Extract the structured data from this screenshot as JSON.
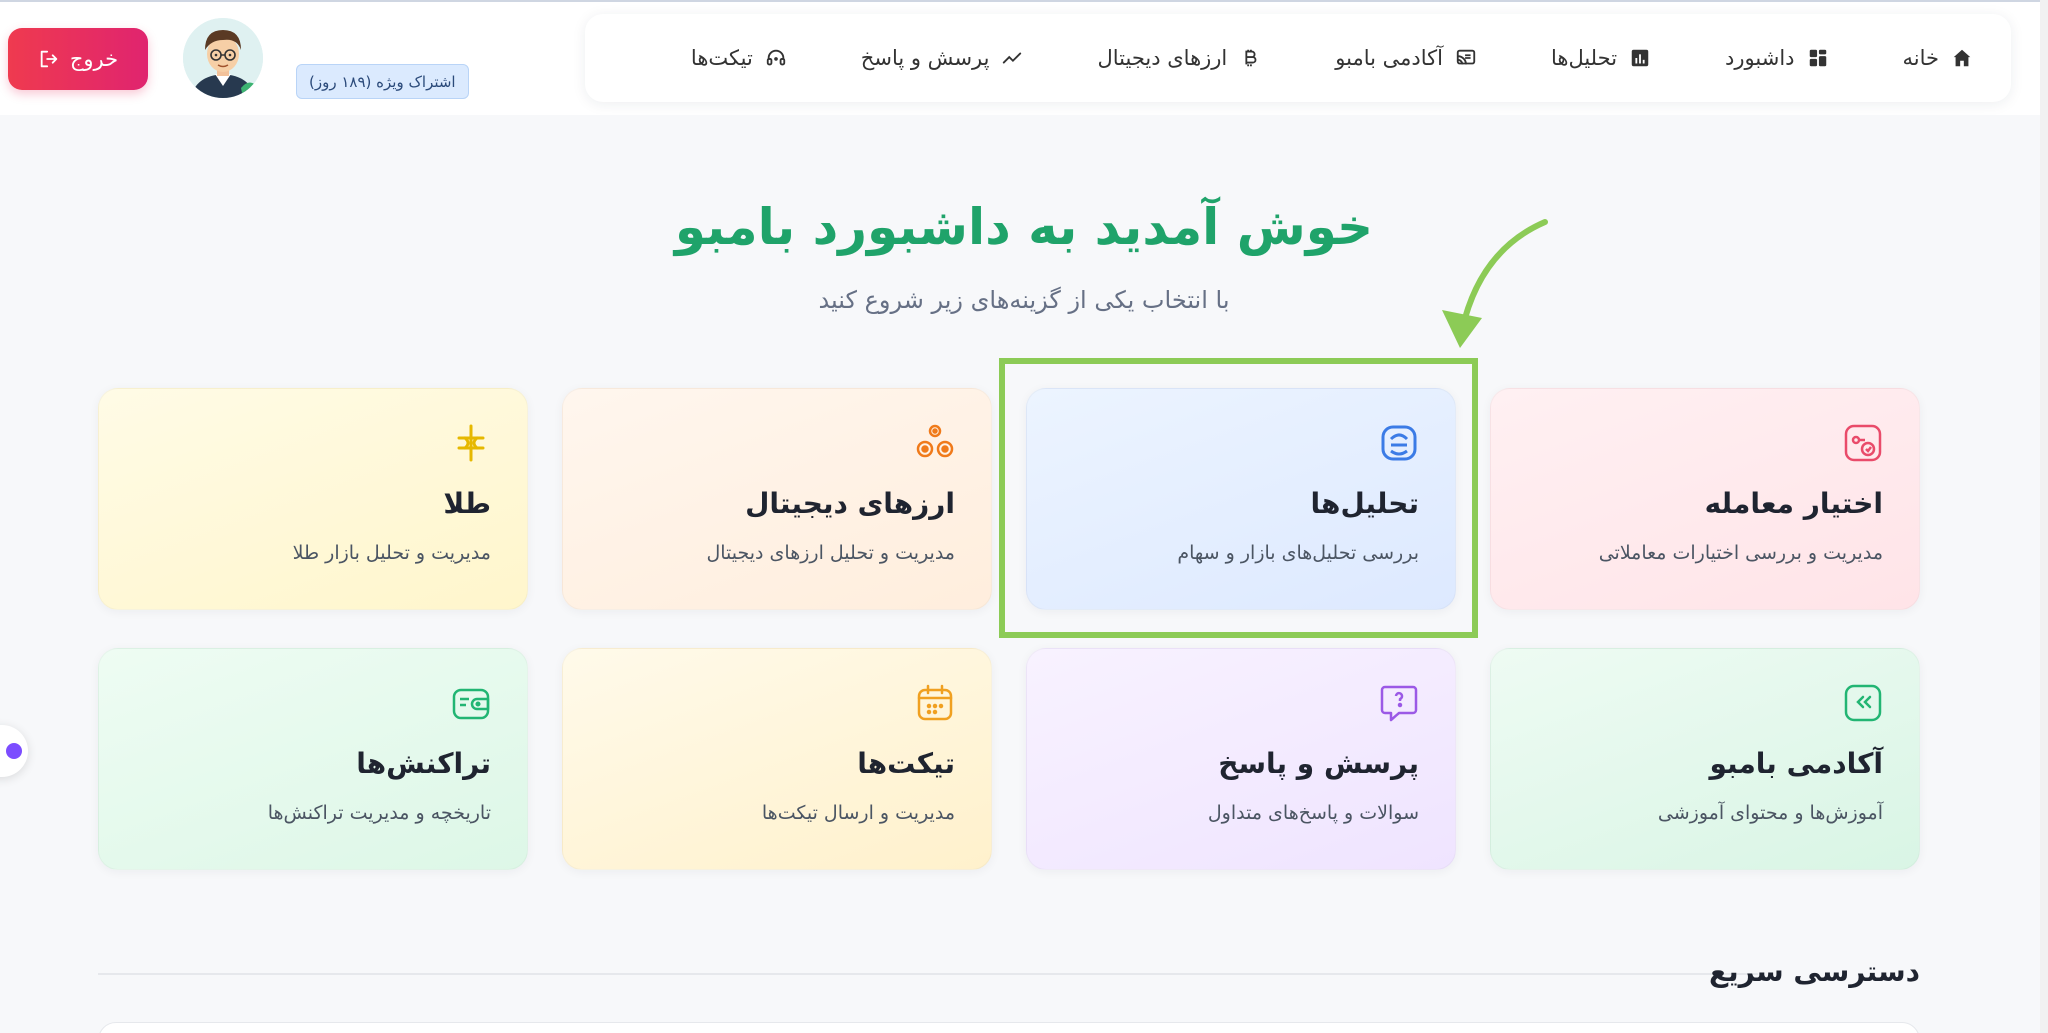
{
  "header": {
    "logout_label": "خروج",
    "subscription_badge": "اشتراک ویژه (۱۸۹ روز)"
  },
  "nav": {
    "items": [
      {
        "label": "خانه",
        "icon": "home-icon"
      },
      {
        "label": "داشبورد",
        "icon": "dashboard-grid-icon"
      },
      {
        "label": "تحلیل‌ها",
        "icon": "bar-chart-icon"
      },
      {
        "label": "آکادمی بامبو",
        "icon": "cast-screen-icon"
      },
      {
        "label": "ارزهای دیجیتال",
        "icon": "bitcoin-icon"
      },
      {
        "label": "پرسش و پاسخ",
        "icon": "trend-line-icon"
      },
      {
        "label": "تیکت‌ها",
        "icon": "headset-icon"
      }
    ]
  },
  "hero": {
    "title": "خوش آمدید به داشبورد بامبو",
    "subtitle": "با انتخاب یکی از گزینه‌های زیر شروع کنید"
  },
  "cards": [
    {
      "title": "اختیار معامله",
      "desc": "مدیریت و بررسی اختیارات معاملاتی",
      "icon": "options-icon",
      "color": "#e94b6a"
    },
    {
      "title": "تحلیل‌ها",
      "desc": "بررسی تحلیل‌های بازار و سهام",
      "icon": "analysis-icon",
      "color": "#3b7be6"
    },
    {
      "title": "ارزهای دیجیتال",
      "desc": "مدیریت و تحلیل ارزهای دیجیتال",
      "icon": "crypto-coins-icon",
      "color": "#f07a1a"
    },
    {
      "title": "طلا",
      "desc": "مدیریت و تحلیل بازار طلا",
      "icon": "gold-icon",
      "color": "#e6b800"
    },
    {
      "title": "آکادمی بامبو",
      "desc": "آموزش‌ها و محتوای آموزشی",
      "icon": "academy-icon",
      "color": "#22b573"
    },
    {
      "title": "پرسش و پاسخ",
      "desc": "سوالات و پاسخ‌های متداول",
      "icon": "question-bubble-icon",
      "color": "#9b59e6"
    },
    {
      "title": "تیکت‌ها",
      "desc": "مدیریت و ارسال تیکت‌ها",
      "icon": "calendar-icon",
      "color": "#f0a020"
    },
    {
      "title": "تراکنش‌ها",
      "desc": "تاریخچه و مدیریت تراکنش‌ها",
      "icon": "wallet-icon",
      "color": "#22b573"
    }
  ],
  "quick_access": {
    "title": "دسترسی سریع"
  },
  "colors": {
    "accent_green": "#1fa36a",
    "highlight": "#8ccb56",
    "logout": "#e0246f"
  }
}
